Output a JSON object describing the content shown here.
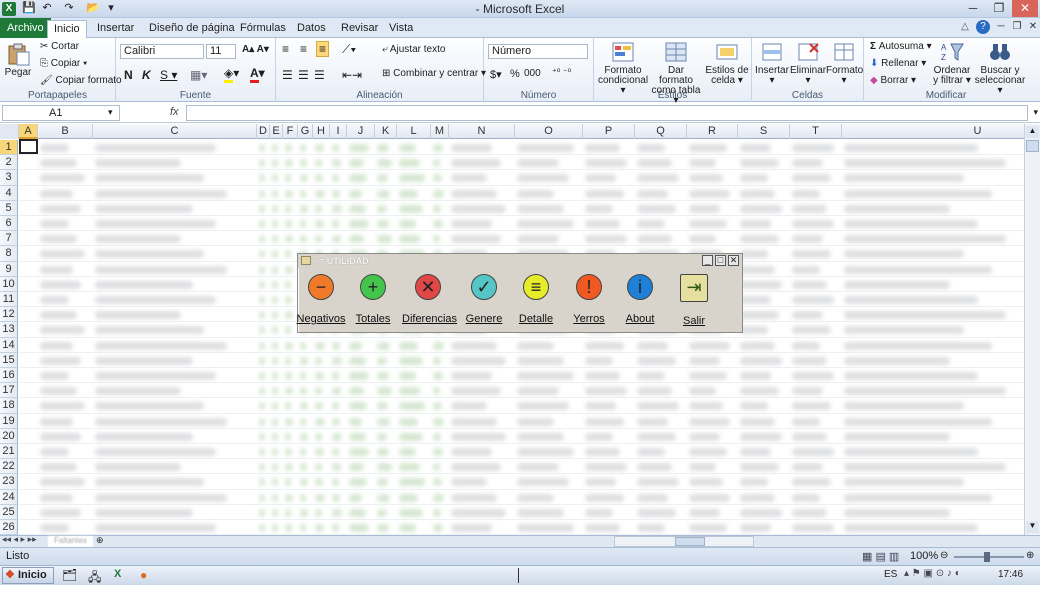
{
  "window": {
    "title": "- Microsoft Excel"
  },
  "quick_access": [
    "save-icon",
    "undo-icon",
    "redo-icon",
    "open-icon"
  ],
  "tabs": [
    "Archivo",
    "Inicio",
    "Insertar",
    "Diseño de página",
    "Fórmulas",
    "Datos",
    "Revisar",
    "Vista"
  ],
  "ribbon": {
    "portapapeles": {
      "label": "Portapapeles",
      "paste": "Pegar",
      "cut": "Cortar",
      "copy": "Copiar",
      "format_painter": "Copiar formato"
    },
    "fuente": {
      "label": "Fuente",
      "font": "Calibri",
      "size": "11"
    },
    "alineacion": {
      "label": "Alineación",
      "wrap": "Ajustar texto",
      "merge": "Combinar y centrar"
    },
    "numero": {
      "label": "Número",
      "format": "Número",
      "currency": "$",
      "percent": "%",
      "thousands": "000"
    },
    "estilos": {
      "label": "Estilos",
      "conditional": [
        "Formato",
        "condicional"
      ],
      "as_table": [
        "Dar formato",
        "como tabla"
      ],
      "cell_styles": [
        "Estilos de",
        "celda"
      ]
    },
    "celdas": {
      "label": "Celdas",
      "insert": "Insertar",
      "delete": "Eliminar",
      "format": "Formato"
    },
    "modificar": {
      "label": "Modificar",
      "autosum": "Autosuma",
      "fill": "Rellenar",
      "clear": "Borrar",
      "sort": [
        "Ordenar",
        "y filtrar"
      ],
      "find": [
        "Buscar y",
        "seleccionar"
      ]
    }
  },
  "formula_bar": {
    "name_box": "A1",
    "fx": "fx",
    "value": ""
  },
  "columns": [
    "A",
    "B",
    "C",
    "D",
    "E",
    "F",
    "G",
    "H",
    "I",
    "J",
    "K",
    "L",
    "M",
    "N",
    "O",
    "P",
    "Q",
    "R",
    "S",
    "T",
    "U"
  ],
  "rows": [
    "1",
    "2",
    "3",
    "4",
    "5",
    "6",
    "7",
    "8",
    "9",
    "10",
    "11",
    "12",
    "13",
    "14",
    "15",
    "16",
    "17",
    "18",
    "19",
    "20",
    "21",
    "22",
    "23",
    "24",
    "25",
    "26"
  ],
  "dialog": {
    "title": "UTILIDAD",
    "buttons": [
      {
        "label": "Negativos",
        "icon": "minus-icon",
        "color": "#f07a2a",
        "glyph": "−"
      },
      {
        "label": "Totales",
        "icon": "plus-icon",
        "color": "#44c44a",
        "glyph": "+"
      },
      {
        "label": "Diferencias",
        "icon": "x-icon",
        "color": "#e04848",
        "glyph": "✕"
      },
      {
        "label": "Genere",
        "icon": "check-icon",
        "color": "#54c6c6",
        "glyph": "✓"
      },
      {
        "label": "Detalle",
        "icon": "list-icon",
        "color": "#e6ec2a",
        "glyph": "≡"
      },
      {
        "label": "Yerros",
        "icon": "exclamation-icon",
        "color": "#f05a22",
        "glyph": "!"
      },
      {
        "label": "About",
        "icon": "info-icon",
        "color": "#1f80d8",
        "glyph": "i"
      },
      {
        "label": "Salir",
        "icon": "exit-door-icon",
        "color": "#e6e0a0",
        "glyph": "⇥"
      }
    ]
  },
  "status": {
    "text": "Listo",
    "zoom": "100%"
  },
  "sheet_tab": "Faltantes",
  "taskbar": {
    "start": "Inicio",
    "lang": "ES",
    "time": "17:46"
  }
}
